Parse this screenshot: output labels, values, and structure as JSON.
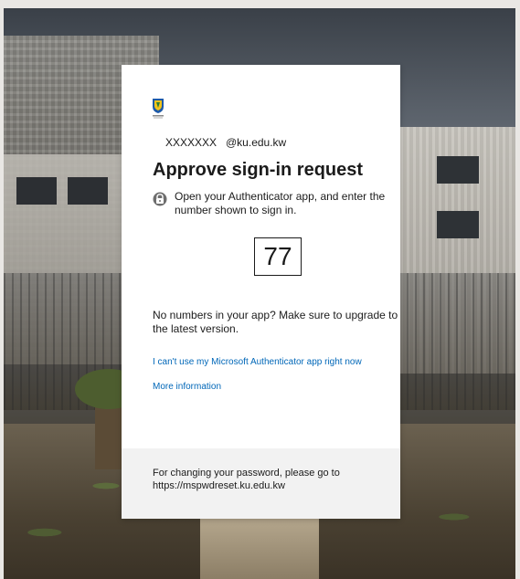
{
  "card": {
    "username": "XXXXXXX",
    "domain": "@ku.edu.kw",
    "title": "Approve sign-in request",
    "instruction": "Open your Authenticator app, and enter the number shown to sign in.",
    "number": "77",
    "upgrade_note": "No numbers in your app? Make sure to upgrade to the latest version.",
    "links": {
      "cant_use": "I can't use my Microsoft Authenticator app right now",
      "more_info": "More information"
    },
    "footer": {
      "line1": "For changing your password, please go to",
      "line2": "https://mspwdreset.ku.edu.kw"
    }
  },
  "icons": {
    "logo": "ku-logo-icon",
    "lock": "authenticator-lock-icon"
  },
  "colors": {
    "link": "#0067b8",
    "text": "#1b1b1b",
    "footer_bg": "#f2f2f2",
    "card_bg": "#ffffff"
  }
}
